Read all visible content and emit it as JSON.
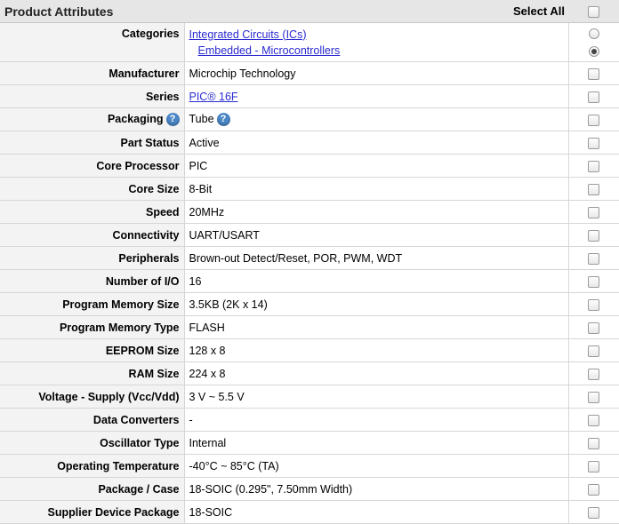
{
  "header": {
    "title": "Product Attributes",
    "select_all": "Select All"
  },
  "categories": {
    "label": "Categories",
    "items": [
      "Integrated Circuits (ICs)",
      "Embedded - Microcontrollers"
    ],
    "selected_index": 1
  },
  "rows": [
    {
      "label": "Manufacturer",
      "value": "Microchip Technology"
    },
    {
      "label": "Series",
      "value": "PIC® 16F",
      "link": true
    },
    {
      "label": "Packaging",
      "value": "Tube",
      "help": "?"
    },
    {
      "label": "Part Status",
      "value": "Active"
    },
    {
      "label": "Core Processor",
      "value": "PIC"
    },
    {
      "label": "Core Size",
      "value": "8-Bit"
    },
    {
      "label": "Speed",
      "value": "20MHz"
    },
    {
      "label": "Connectivity",
      "value": "UART/USART"
    },
    {
      "label": "Peripherals",
      "value": "Brown-out Detect/Reset, POR, PWM, WDT"
    },
    {
      "label": "Number of I/O",
      "value": "16"
    },
    {
      "label": "Program Memory Size",
      "value": "3.5KB (2K x 14)"
    },
    {
      "label": "Program Memory Type",
      "value": "FLASH"
    },
    {
      "label": "EEPROM Size",
      "value": "128 x 8"
    },
    {
      "label": "RAM Size",
      "value": "224 x 8"
    },
    {
      "label": "Voltage - Supply (Vcc/Vdd)",
      "value": "3 V ~ 5.5 V"
    },
    {
      "label": "Data Converters",
      "value": "-"
    },
    {
      "label": "Oscillator Type",
      "value": "Internal"
    },
    {
      "label": "Operating Temperature",
      "value": "-40°C ~ 85°C (TA)"
    },
    {
      "label": "Package / Case",
      "value": "18-SOIC (0.295\", 7.50mm Width)"
    },
    {
      "label": "Supplier Device Package",
      "value": "18-SOIC"
    }
  ],
  "icons": {
    "help": "help-icon",
    "checkbox": "checkbox",
    "radio": "radio-button"
  },
  "colors": {
    "link": "#2a2ad0",
    "help": "#4a86c6",
    "header_bg": "#e6e6e6",
    "label_bg": "#f3f3f3"
  }
}
